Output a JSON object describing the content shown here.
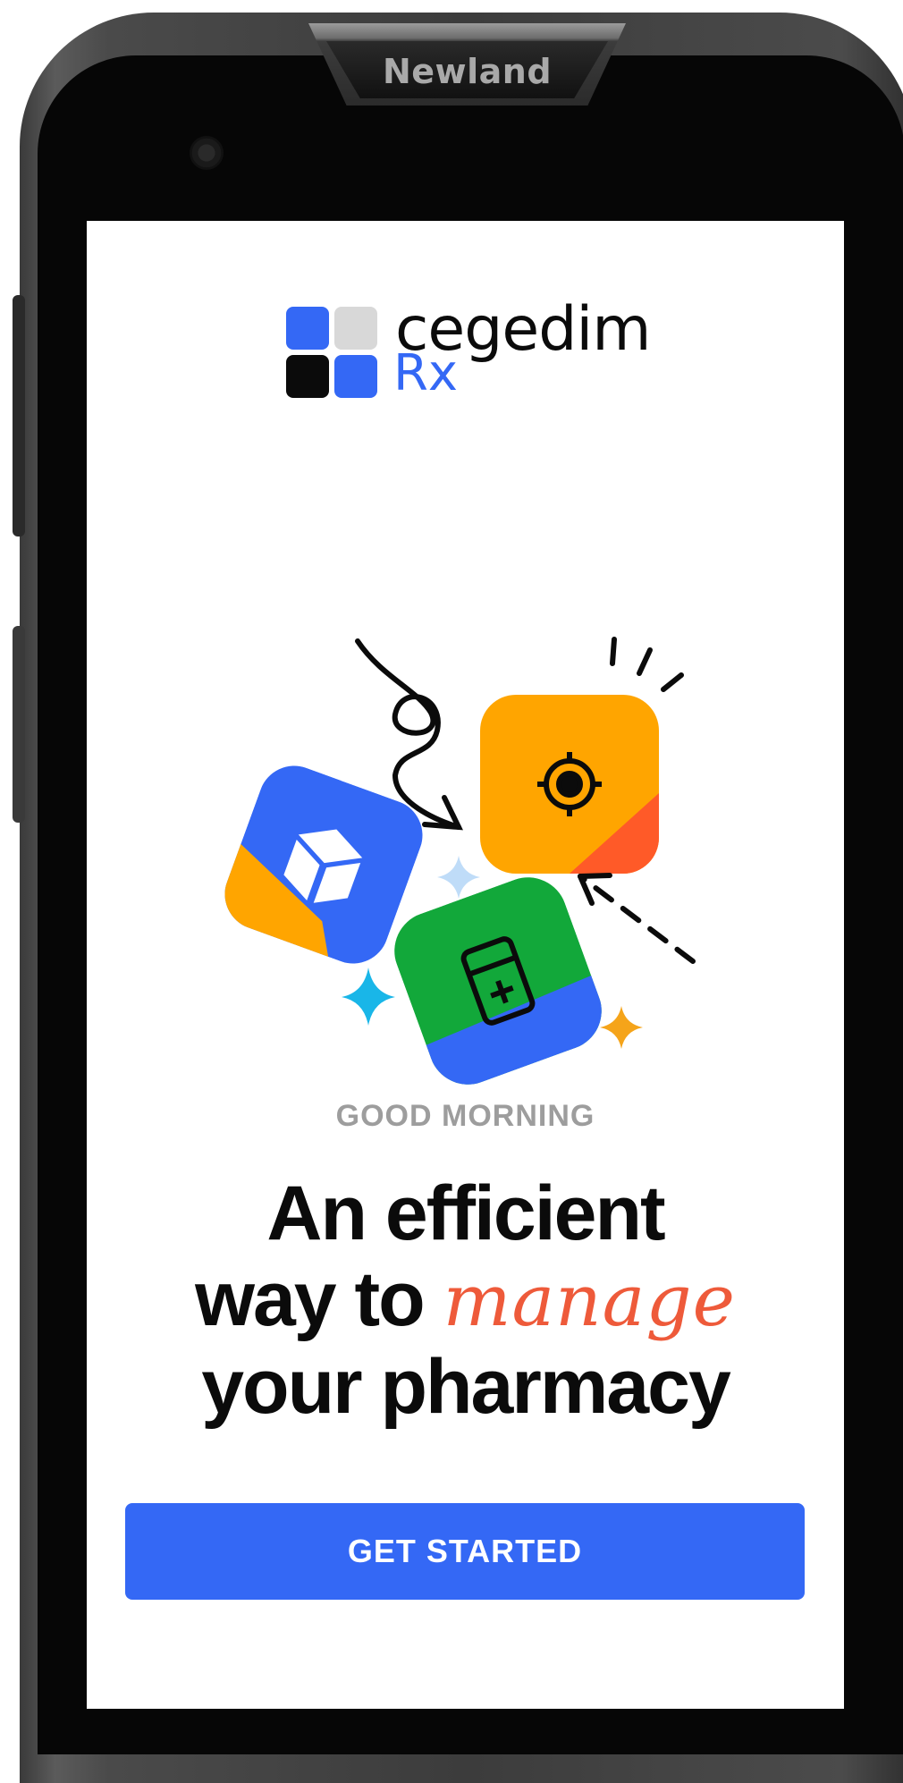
{
  "device": {
    "brand": "Newland"
  },
  "logo": {
    "word": "cegedim",
    "product": "Rx",
    "colors": {
      "blue": "#3468f5",
      "grey": "#d8d8d8",
      "black": "#0b0b0b"
    }
  },
  "illustration": {
    "tiles": [
      {
        "icon": "target-icon",
        "color": "#ffa500",
        "accent": "#ff5a28"
      },
      {
        "icon": "box-icon",
        "color": "#3468f5",
        "accent": "#ffa500"
      },
      {
        "icon": "medicine-calculator-icon",
        "color": "#12a83a",
        "accent": "#3468f5"
      }
    ],
    "sparkles": [
      "#bfdcf8",
      "#19b6e8",
      "#f5a41a"
    ]
  },
  "greeting": "GOOD MORNING",
  "headline": {
    "line1": "An efficient",
    "line2_prefix": "way to",
    "line2_script": "manage",
    "line3": "your pharmacy"
  },
  "cta": {
    "label": "GET STARTED",
    "color": "#3468f5"
  }
}
